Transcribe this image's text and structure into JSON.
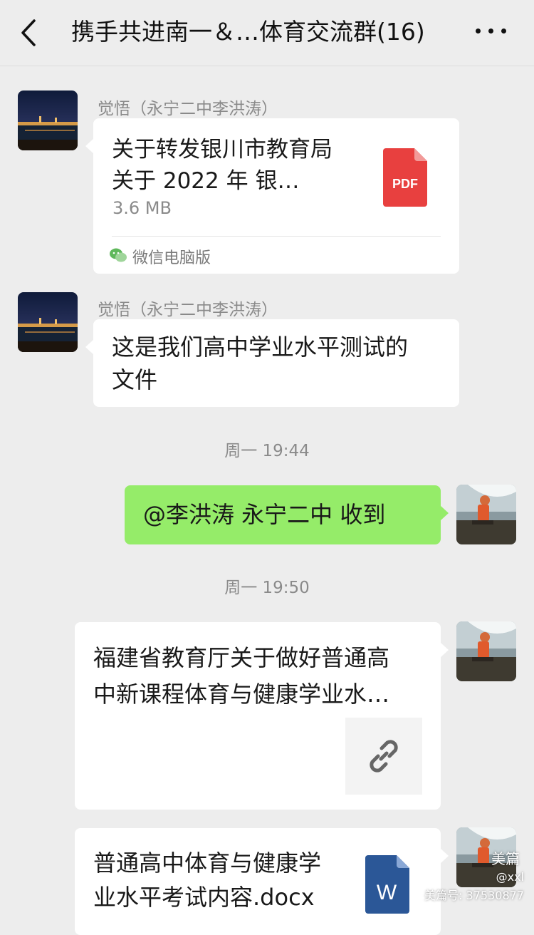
{
  "header": {
    "title": "携手共进南一＆…体育交流群(16)",
    "back_icon": "chevron-left-icon",
    "more_icon": "ellipsis-icon"
  },
  "messages": {
    "m1": {
      "sender": "觉悟（永宁二中李洪涛）",
      "file_title_line1": "关于转发银川市教育局",
      "file_title_line2": "关于 2022 年 银…",
      "file_size": "3.6 MB",
      "file_icon_label": "PDF",
      "source": "微信电脑版"
    },
    "m2": {
      "sender": "觉悟（永宁二中李洪涛）",
      "text_line1": "这是我们高中学业水平测试的",
      "text_line2": "文件"
    },
    "t1": "周一 19:44",
    "m3": {
      "text": "@李洪涛  永宁二中  收到"
    },
    "t2": "周一 19:50",
    "m4": {
      "title_line1": "福建省教育厅关于做好普通高",
      "title_line2": "中新课程体育与健康学业水…",
      "thumb_icon": "link-icon"
    },
    "m5": {
      "title_line1": "普通高中体育与健康学",
      "title_line2": "业水平考试内容.docx",
      "file_icon_label": "W"
    }
  },
  "watermark": {
    "logo": "美篇",
    "user": "@xxl",
    "id": "美篇号: 37530877"
  },
  "colors": {
    "background": "#ededed",
    "bubble": "#ffffff",
    "self_bubble": "#95ec69",
    "pdf_red": "#e8403f",
    "word_blue": "#2b5797"
  }
}
